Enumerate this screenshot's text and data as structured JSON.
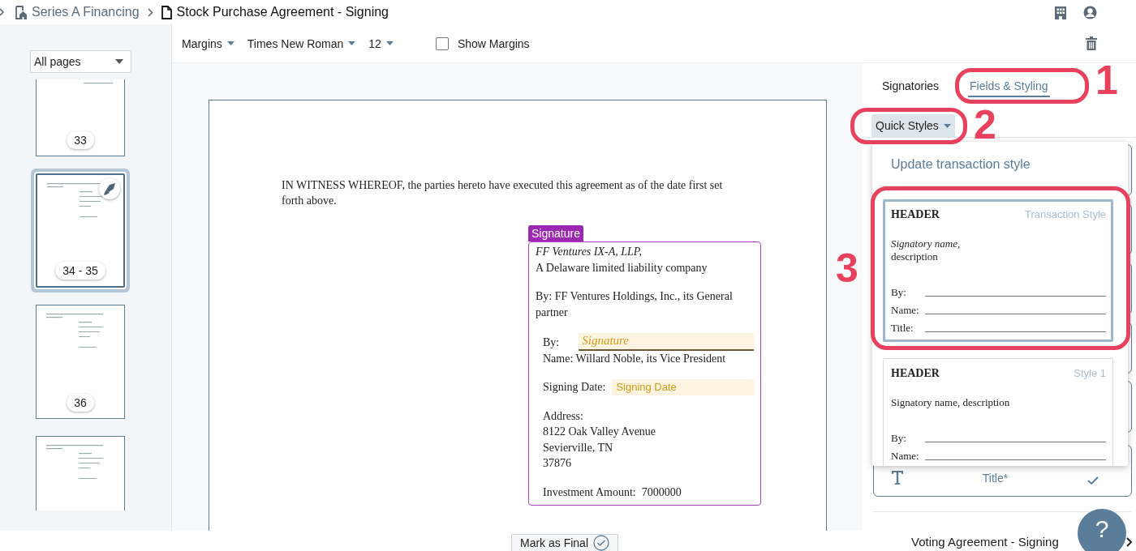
{
  "breadcrumbs": [
    {
      "label": "Series A Financing",
      "kind": "folder"
    },
    {
      "label": "Stock Purchase Agreement - Signing",
      "kind": "document"
    }
  ],
  "toolbar": {
    "margins": "Margins",
    "font": "Times New Roman",
    "size": "12",
    "show_margins": {
      "label": "Show Margins",
      "checked": false
    }
  },
  "pages_filter": "All pages",
  "thumbnails": [
    {
      "label": "33",
      "selected": false,
      "signature": false
    },
    {
      "label": "34 - 35",
      "selected": true,
      "signature": true
    },
    {
      "label": "36",
      "selected": false,
      "signature": false
    },
    {
      "selected": false,
      "signature": false
    }
  ],
  "document": {
    "paragraph": "IN WITNESS WHEREOF, the parties hereto have executed this agreement as of the date first set forth above.",
    "signature_block": {
      "tag": "Signature",
      "entity": "FF Ventures IX-A, LLP,",
      "entity_desc": "A Delaware limited liability company",
      "by_line": "By: FF Ventures Holdings, Inc., its General partner",
      "by_label": "By:",
      "signature_field": "Signature",
      "name_line": "Name: Willard Noble, its Vice President",
      "date_label": "Signing Date:",
      "date_field": "Signing Date",
      "address": [
        "Address:",
        "8122 Oak Valley Avenue",
        "Sevierville, TN",
        "37876"
      ],
      "investment": "Investment Amount:  7000000"
    }
  },
  "right_panel": {
    "tabs": [
      {
        "label": "Signatories",
        "selected": false
      },
      {
        "label": "Fields & Styling",
        "selected": true
      }
    ],
    "quick_styles": "Quick Styles",
    "fields": [
      {
        "label": "Title*",
        "checked": true
      }
    ],
    "menu": {
      "title": "Update transaction style",
      "styles": [
        {
          "header": "HEADER",
          "name": "Transaction Style",
          "selected": true,
          "signatory": [
            {
              "text": "Signatory name,",
              "italic": true
            },
            {
              "text": "description",
              "italic": false
            }
          ],
          "lines": [
            "By:",
            "Name:",
            "Title:"
          ]
        },
        {
          "header": "HEADER",
          "name": "Style 1",
          "selected": false,
          "signatory": [
            {
              "text": "Signatory name, description",
              "italic": false
            }
          ],
          "lines": [
            "By:",
            "Name:"
          ]
        }
      ]
    }
  },
  "annotations": [
    {
      "label": "1"
    },
    {
      "label": "2"
    },
    {
      "label": "3"
    }
  ],
  "footer": {
    "mark_final": "Mark as Final",
    "next_document": "Voting Agreement - Signing",
    "help": "?"
  }
}
